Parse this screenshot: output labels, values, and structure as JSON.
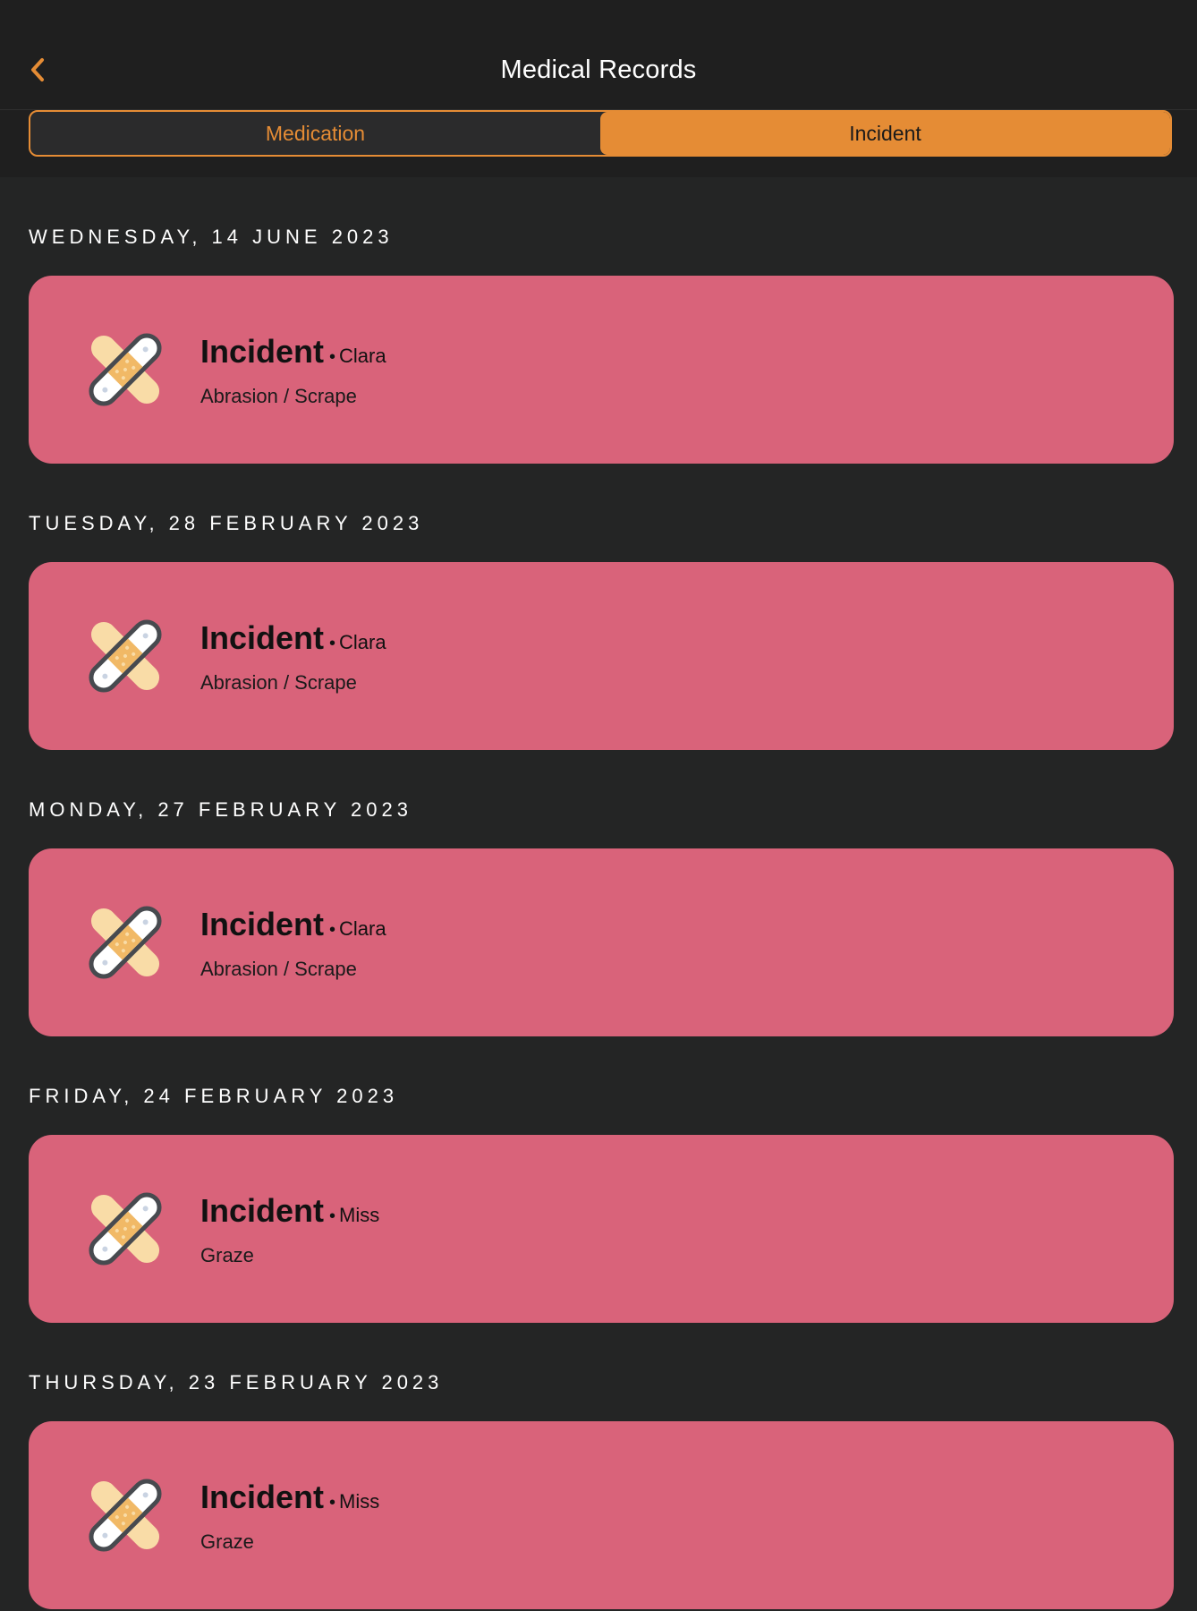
{
  "header": {
    "title": "Medical Records",
    "back_icon": "chevron-left-icon"
  },
  "tabs": [
    {
      "label": "Medication",
      "selected": false
    },
    {
      "label": "Incident",
      "selected": true
    }
  ],
  "colors": {
    "accent": "#e58c35",
    "card": "#d9637a",
    "background": "#242525"
  },
  "records": [
    {
      "date": "WEDNESDAY, 14 JUNE 2023",
      "type": "Incident",
      "person": "Clara",
      "detail": "Abrasion / Scrape",
      "icon": "bandage-icon"
    },
    {
      "date": "TUESDAY, 28 FEBRUARY 2023",
      "type": "Incident",
      "person": "Clara",
      "detail": "Abrasion / Scrape",
      "icon": "bandage-icon"
    },
    {
      "date": "MONDAY, 27 FEBRUARY 2023",
      "type": "Incident",
      "person": "Clara",
      "detail": "Abrasion / Scrape",
      "icon": "bandage-icon"
    },
    {
      "date": "FRIDAY, 24 FEBRUARY 2023",
      "type": "Incident",
      "person": "Miss",
      "detail": "Graze",
      "icon": "bandage-icon"
    },
    {
      "date": "THURSDAY, 23 FEBRUARY 2023",
      "type": "Incident",
      "person": "Miss",
      "detail": "Graze",
      "icon": "bandage-icon"
    }
  ]
}
